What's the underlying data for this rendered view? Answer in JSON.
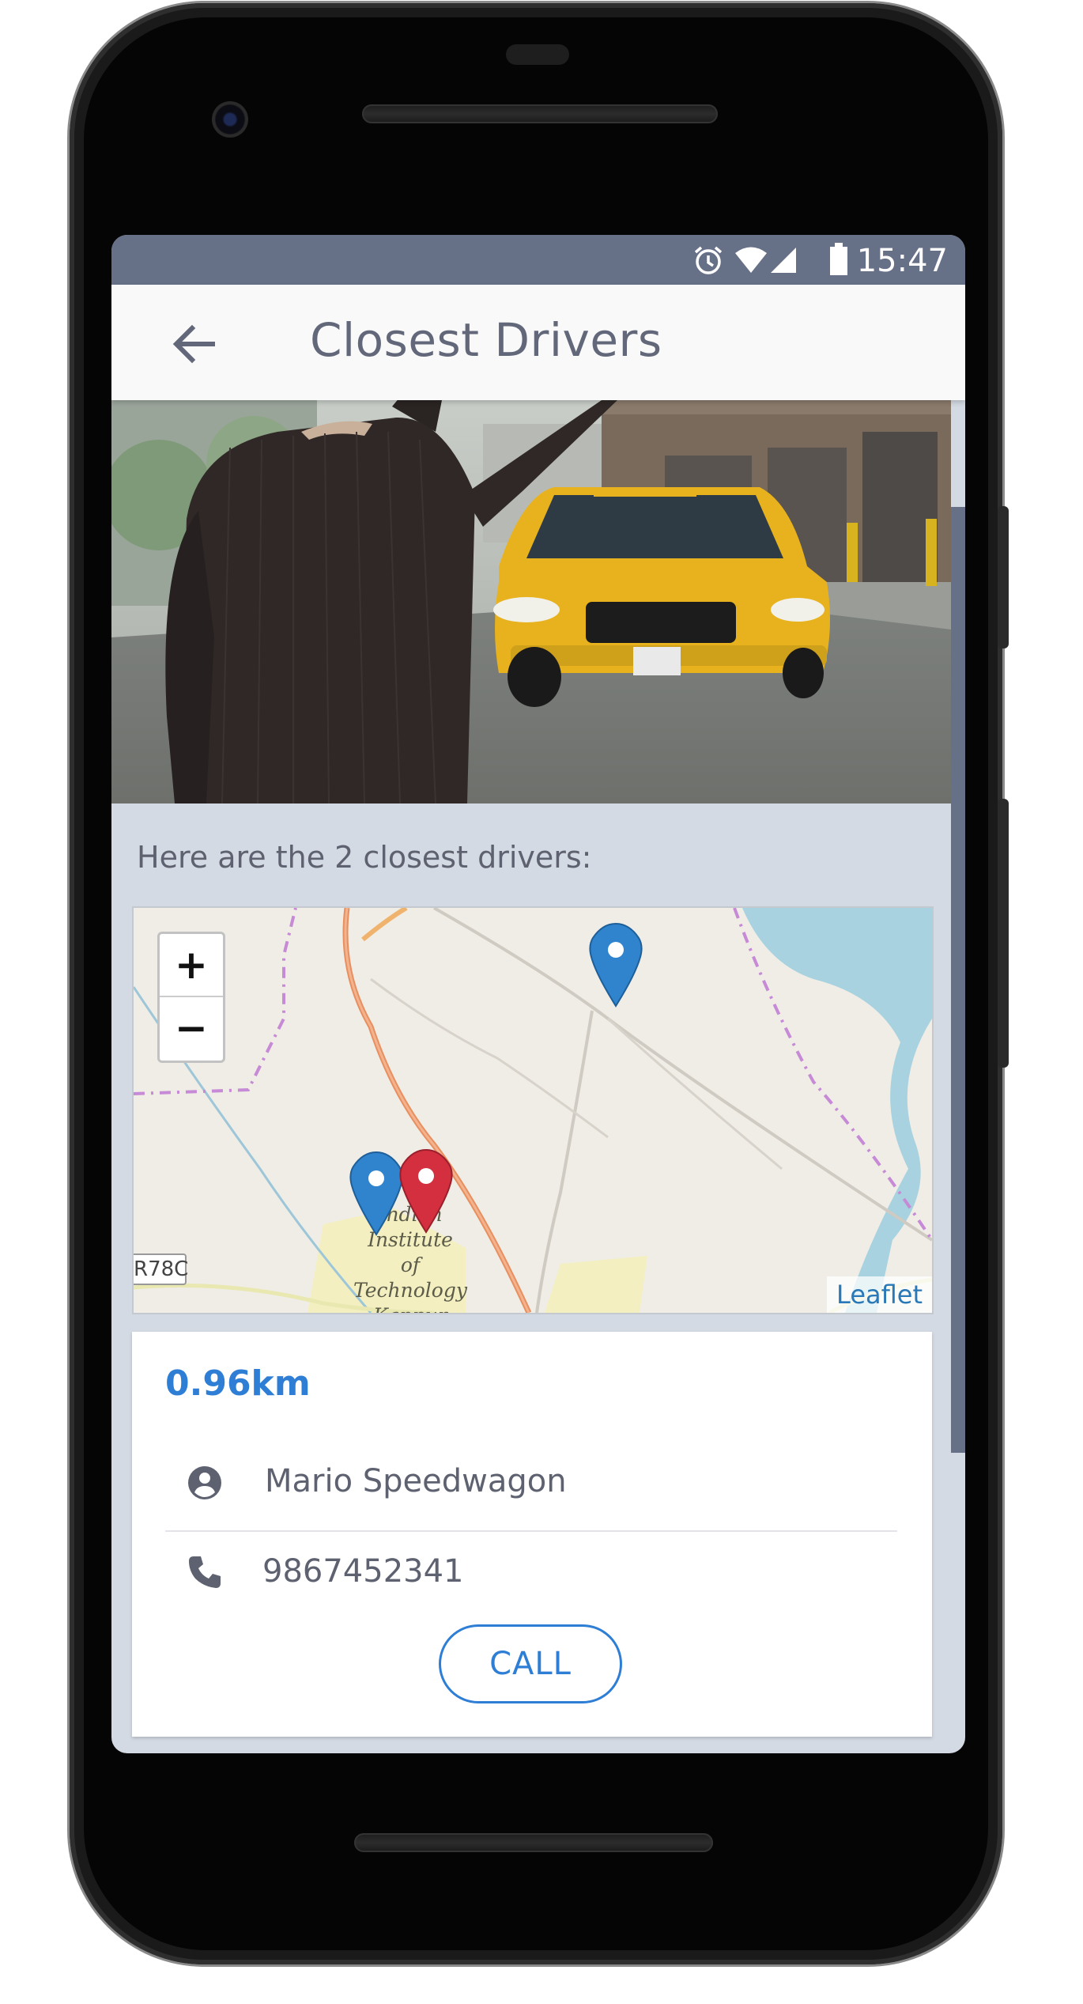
{
  "status_bar": {
    "time": "15:47",
    "icons": [
      "alarm-icon",
      "wifi-icon",
      "signal-icon",
      "battery-icon"
    ]
  },
  "app_bar": {
    "title": "Closest Drivers",
    "back_icon": "arrow-left-icon"
  },
  "hero_image": {
    "subject": "man-hailing-yellow-taxi-photo"
  },
  "intro_text": "Here are the 2 closest drivers:",
  "map": {
    "zoom_in": "+",
    "zoom_out": "−",
    "attribution": "Leaflet",
    "labels": {
      "road": "R78C",
      "place_line1": "Indian",
      "place_line2": "Institute",
      "place_line3": "of Technology",
      "place_line4": "Kanpur"
    },
    "markers": [
      {
        "kind": "driver",
        "color": "#2f84cd"
      },
      {
        "kind": "driver",
        "color": "#2f84cd"
      },
      {
        "kind": "user",
        "color": "#d32f3f"
      }
    ]
  },
  "driver_card": {
    "distance": "0.96km",
    "name": "Mario Speedwagon",
    "phone": "9867452341",
    "call_label": "CALL"
  },
  "colors": {
    "status_bar": "#667087",
    "accent": "#2f7ed6",
    "content_bg": "#d4dae3",
    "title_text": "#62687a"
  }
}
